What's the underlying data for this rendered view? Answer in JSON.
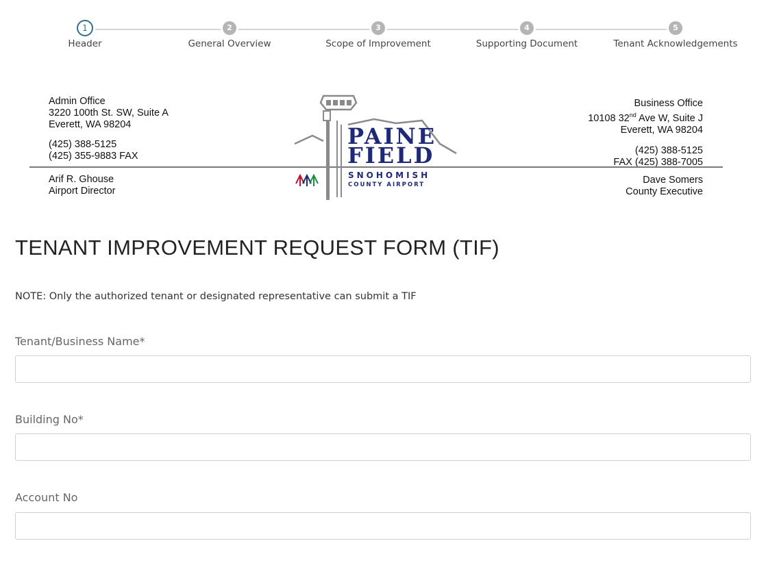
{
  "stepper": {
    "steps": [
      {
        "number": "1",
        "label": "Header"
      },
      {
        "number": "2",
        "label": "General Overview"
      },
      {
        "number": "3",
        "label": "Scope of Improvement"
      },
      {
        "number": "4",
        "label": "Supporting Document"
      },
      {
        "number": "5",
        "label": "Tenant Acknowledgements"
      }
    ],
    "active_step": 1,
    "active_color": "#2d6f8e",
    "inactive_color": "#b5b5b5"
  },
  "letterhead": {
    "admin_office": {
      "title": "Admin Office",
      "address1": "3220 100th St. SW, Suite A",
      "address2": "Everett, WA 98204",
      "phone": "(425) 388-5125",
      "fax": "(425) 355-9883 FAX"
    },
    "director": {
      "name": "Arif R. Ghouse",
      "title": "Airport Director"
    },
    "business_office": {
      "title": "Business Office",
      "address1_prefix": "10108 32",
      "address1_sup": "nd",
      "address1_suffix": " Ave W, Suite J",
      "address2": "Everett, WA 98204",
      "phone": "(425) 388-5125",
      "fax": "FAX (425) 388-7005"
    },
    "executive": {
      "name": "Dave Somers",
      "title": "County Executive"
    },
    "logo": {
      "line1": "PAINE",
      "line2": "FIELD",
      "line3": "SNOHOMISH",
      "line4": "COUNTY AIRPORT",
      "brand_color": "#1e2a78"
    }
  },
  "form": {
    "title": "TENANT IMPROVEMENT REQUEST FORM (TIF)",
    "note": "NOTE: Only the authorized tenant or designated representative can submit a TIF",
    "fields": [
      {
        "label": "Tenant/Business Name*",
        "value": ""
      },
      {
        "label": "Building No*",
        "value": ""
      },
      {
        "label": "Account No",
        "value": ""
      }
    ]
  }
}
